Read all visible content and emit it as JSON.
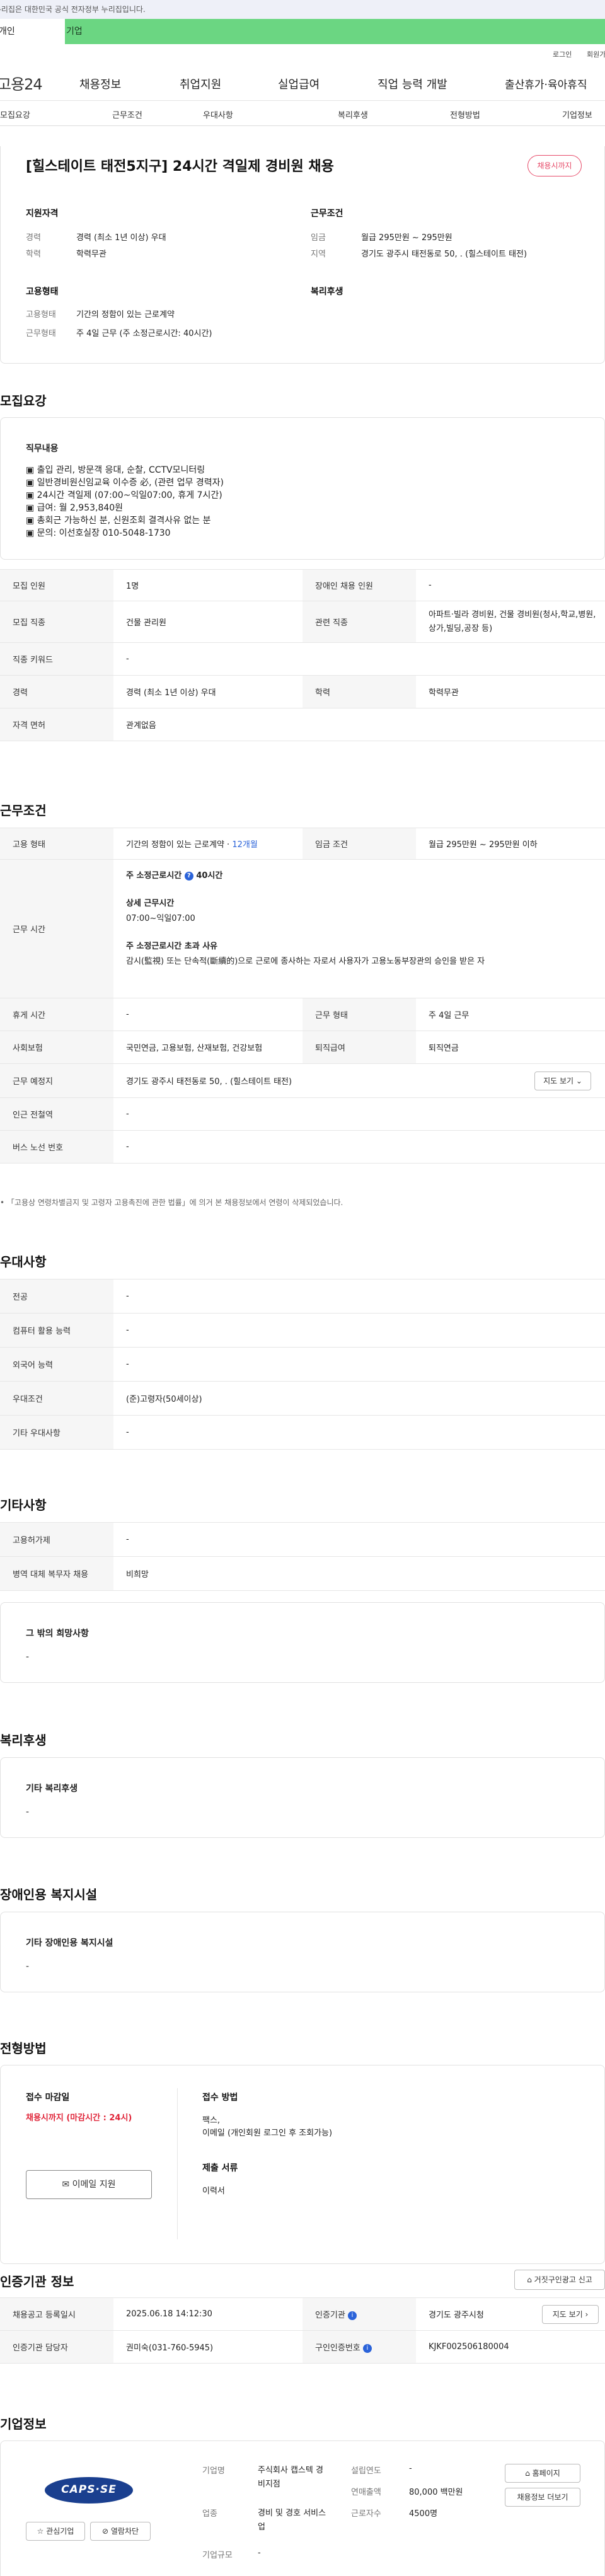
{
  "gov_banner": "이 누리집은 대한민국 공식 전자정부 누리집입니다.",
  "member_tabs": {
    "individual": "개인",
    "company": "기업"
  },
  "util_links": {
    "login": "로그인",
    "join": "회원가입"
  },
  "gnb": {
    "logo": "고용24",
    "menu": [
      "채용정보",
      "취업지원",
      "실업급여",
      "직업 능력 개발",
      "출산휴가·육아휴직"
    ]
  },
  "subnav": [
    "모집요강",
    "근무조건",
    "우대사항",
    "복리후생",
    "전형방법",
    "기업정보"
  ],
  "job": {
    "title": "[힐스테이트 태전5지구] 24시간 격일제 경비원 채용",
    "status_badge": "채용시까지",
    "qualification": {
      "heading": "지원자격",
      "rows": [
        {
          "label": "경력",
          "value": "경력 (최소 1년 이상) 우대"
        },
        {
          "label": "학력",
          "value": "학력무관"
        }
      ]
    },
    "conditions": {
      "heading": "근무조건",
      "rows": [
        {
          "label": "임금",
          "value": "월급 295만원 ~ 295만원"
        },
        {
          "label": "지역",
          "value": "경기도 광주시 태전동로 50, . (힐스테이트 태전)"
        }
      ]
    },
    "employment": {
      "heading": "고용형태",
      "rows": [
        {
          "label": "고용형태",
          "value": "기간의 정함이 있는 근로계약"
        },
        {
          "label": "근무형태",
          "value": "주 4일 근무 (주 소정근로시간: 40시간)"
        }
      ]
    },
    "welfare_heading": "복리후생"
  },
  "recruit": {
    "section_title": "모집요강",
    "duty_heading": "직무내용",
    "duty_lines": [
      "▣ 출입 관리, 방문객 응대, 순찰, CCTV모니터링",
      "▣ 일반경비원신임교육 이수증 必, (관련 업무 경력자)",
      "▣ 24시간 격일제 (07:00~익일07:00, 휴게 7시간)",
      "▣ 급여: 월 2,953,840원",
      "▣ 총회근 가능하신 분, 신원조회 결격사유 없는 분",
      "▣ 문의: 이선호실장 010-5048-1730"
    ],
    "table": [
      [
        {
          "h": "모집 인원"
        },
        {
          "v": "1명"
        },
        {
          "h": "장애인 채용 인원"
        },
        {
          "v": "-"
        }
      ],
      [
        {
          "h": "모집 직종"
        },
        {
          "v": "건물 관리원"
        },
        {
          "h": "관련 직종"
        },
        {
          "v": "아파트·빌라 경비원, 건물 경비원(청사,학교,병원,상가,빌딩,공장 등)"
        }
      ],
      [
        {
          "h": "직종 키워드"
        },
        {
          "v": "-"
        }
      ],
      [
        {
          "h": "경력"
        },
        {
          "v": "경력 (최소 1년 이상) 우대"
        },
        {
          "h": "학력"
        },
        {
          "v": "학력무관"
        }
      ],
      [
        {
          "h": "자격 면허"
        },
        {
          "v": "관계없음"
        }
      ]
    ]
  },
  "work": {
    "section_title": "근무조건",
    "employment_label": "고용 형태",
    "employment_value": "기간의 정함이 있는 근로계약 · ",
    "employment_months": "12개월",
    "wage_label": "임금 조건",
    "wage_value": "월급 295만원 ~ 295만원 이하",
    "hours_label": "근무 시간",
    "hours_weekly_label": "주 소정근로시간",
    "hours_weekly_value": "40시간",
    "hours_detail_label": "상세 근무시간",
    "hours_detail_value": "07:00~익일07:00",
    "hours_excess_label": "주 소정근로시간 초과 사유",
    "hours_excess_value": "감시(監視) 또는 단속적(斷續的)으로 근로에 종사하는 자로서 사용자가 고용노동부장관의 승인을 받은 자",
    "rest_label": "휴게 시간",
    "rest_value": "-",
    "worktype_label": "근무 형태",
    "worktype_value": "주 4일 근무",
    "insurance_label": "사회보험",
    "insurance_value": "국민연금, 고용보험, 산재보험, 건강보험",
    "retire_label": "퇴직급여",
    "retire_value": "퇴직연금",
    "place_label": "근무 예정지",
    "place_value": "경기도 광주시 태전동로 50, . (힐스테이트 태전)",
    "map_button": "지도 보기",
    "station_label": "인근 전철역",
    "station_value": "-",
    "bus_label": "버스 노선 번호",
    "bus_value": "-",
    "note": "「고용상 연령차별금지 및 고령자 고용촉진에 관한 법률」에 의거 본 채용정보에서 연령이 삭제되었습니다."
  },
  "preference": {
    "section_title": "우대사항",
    "table": [
      [
        {
          "h": "전공"
        },
        {
          "v": "-"
        }
      ],
      [
        {
          "h": "컴퓨터 활용 능력"
        },
        {
          "v": "-"
        }
      ],
      [
        {
          "h": "외국어 능력"
        },
        {
          "v": "-"
        }
      ],
      [
        {
          "h": "우대조건"
        },
        {
          "v": "(준)고령자(50세이상)"
        }
      ],
      [
        {
          "h": "기타 우대사항"
        },
        {
          "v": "-"
        }
      ]
    ]
  },
  "etc": {
    "section_title": "기타사항",
    "table": [
      [
        {
          "h": "고용허가제"
        },
        {
          "v": "-"
        }
      ],
      [
        {
          "h": "병역 대체 복무자 채용"
        },
        {
          "v": "비희망"
        }
      ]
    ],
    "other_heading": "그 밖의 희망사항",
    "other_value": "-"
  },
  "benefit": {
    "section_title": "복리후생",
    "heading": "기타 복리후생",
    "value": "-"
  },
  "disability": {
    "section_title": "장애인용 복지시설",
    "heading": "기타 장애인용 복지시설",
    "value": "-"
  },
  "selection": {
    "section_title": "전형방법",
    "deadline_label": "접수 마감일",
    "deadline_value": "채용시까지 (마감시간 : 24시)",
    "email_button": "이메일 지원",
    "method_label": "접수 방법",
    "method_lines": [
      "팩스,",
      "이메일 (개인회원 로그인 후 조회가능)"
    ],
    "docs_label": "제출 서류",
    "docs_value": "이력서"
  },
  "certification": {
    "section_title": "인증기관 정보",
    "report_button": "거짓구인광고 신고",
    "registered_label": "채용공고 등록일시",
    "registered_value": "2025.06.18 14:12:30",
    "agency_label": "인증기관",
    "agency_value": "경기도 광주시청",
    "map_button": "지도 보기",
    "manager_label": "인증기관 담당자",
    "manager_value": "권미숙(031-760-5945)",
    "number_label": "구인인증번호",
    "number_value": "KJKF002506180004"
  },
  "company": {
    "section_title": "기업정보",
    "logo_text": "CAPS·SE",
    "interest_button": "관심기업",
    "block_button": "열람차단",
    "name_label": "기업명",
    "name_value": "주식회사 캡스텍 경비지점",
    "industry_label": "업종",
    "industry_value": "경비 및 경호 서비스업",
    "size_label": "기업규모",
    "size_value": "-",
    "founded_label": "설립연도",
    "founded_value": "-",
    "sales_label": "연매출액",
    "sales_value": "80,000 백만원",
    "staff_label": "근로자수",
    "staff_value": "4500명",
    "homepage_button": "홈페이지",
    "jobs_button": "채용정보 더보기"
  },
  "colors": {
    "accent_green": "#6bd682",
    "badge_red": "#e74c6a",
    "link_blue": "#2b63d9"
  }
}
